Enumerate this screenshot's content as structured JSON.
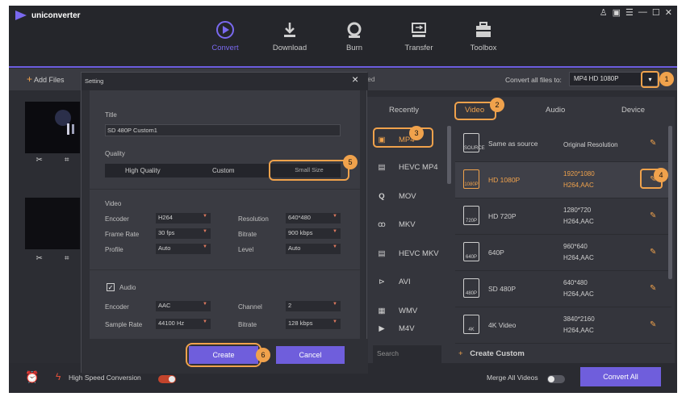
{
  "app": {
    "name": "uniconverter"
  },
  "window_controls": [
    "♙",
    "▣",
    "☰",
    "—",
    "☐",
    "✕"
  ],
  "nav": [
    {
      "label": "Convert",
      "icon": "convert-icon",
      "active": true
    },
    {
      "label": "Download",
      "icon": "download-icon"
    },
    {
      "label": "Burn",
      "icon": "burn-icon"
    },
    {
      "label": "Transfer",
      "icon": "transfer-icon"
    },
    {
      "label": "Toolbox",
      "icon": "toolbox-icon"
    }
  ],
  "subbar": {
    "add_files": "Add Files",
    "converted_partial": "verted",
    "convert_all_label": "Convert all files to:",
    "format_selected": "MP4 HD 1080P"
  },
  "dialog": {
    "title": "Setting",
    "title_label": "Title",
    "title_value": "SD 480P Custom1",
    "quality_label": "Quality",
    "quality_options": [
      "High Quality",
      "Custom",
      "Small Size"
    ],
    "video_label": "Video",
    "encoder_label": "Encoder",
    "encoder": "H264",
    "resolution_label": "Resolution",
    "resolution": "640*480",
    "framerate_label": "Frame Rate",
    "framerate": "30 fps",
    "bitrate_label": "Bitrate",
    "video_bitrate": "900 kbps",
    "profile_label": "Profile",
    "profile": "Auto",
    "level_label": "Level",
    "level": "Auto",
    "audio_label": "Audio",
    "audio_encoder": "AAC",
    "channel_label": "Channel",
    "channel": "2",
    "samplerate_label": "Sample Rate",
    "samplerate": "44100 Hz",
    "audio_bitrate": "128 kbps",
    "create": "Create",
    "cancel": "Cancel"
  },
  "panel": {
    "tabs": [
      "Recently",
      "Video",
      "Audio",
      "Device"
    ],
    "formats": [
      {
        "label": "MP4",
        "icon": "film-icon",
        "selected": true
      },
      {
        "label": "HEVC MP4",
        "icon": "hevc-icon"
      },
      {
        "label": "MOV",
        "icon": "quicktime-icon"
      },
      {
        "label": "MKV",
        "icon": "mkv-icon"
      },
      {
        "label": "HEVC MKV",
        "icon": "hevc-icon"
      },
      {
        "label": "AVI",
        "icon": "avi-icon"
      },
      {
        "label": "WMV",
        "icon": "wmv-icon"
      },
      {
        "label": "M4V",
        "icon": "m4v-icon"
      }
    ],
    "presets": [
      {
        "name": "Same as source",
        "res": "Original Resolution",
        "codec": "",
        "tag": "SOURCE"
      },
      {
        "name": "HD 1080P",
        "res": "1920*1080",
        "codec": "H264,AAC",
        "tag": "1080P",
        "selected": true
      },
      {
        "name": "HD 720P",
        "res": "1280*720",
        "codec": "H264,AAC",
        "tag": "720P"
      },
      {
        "name": "640P",
        "res": "960*640",
        "codec": "H264,AAC",
        "tag": "640P"
      },
      {
        "name": "SD 480P",
        "res": "640*480",
        "codec": "H264,AAC",
        "tag": "480P"
      },
      {
        "name": "4K Video",
        "res": "3840*2160",
        "codec": "H264,AAC",
        "tag": "4K"
      }
    ],
    "search_placeholder": "Search",
    "create_custom": "Create Custom"
  },
  "footer": {
    "high_speed": "High Speed Conversion",
    "merge": "Merge All Videos",
    "convert_all": "Convert All"
  },
  "callouts": [
    "1",
    "2",
    "3",
    "4",
    "5",
    "6"
  ],
  "colors": {
    "accent": "#6f5edc",
    "highlight": "#f0a24c"
  }
}
